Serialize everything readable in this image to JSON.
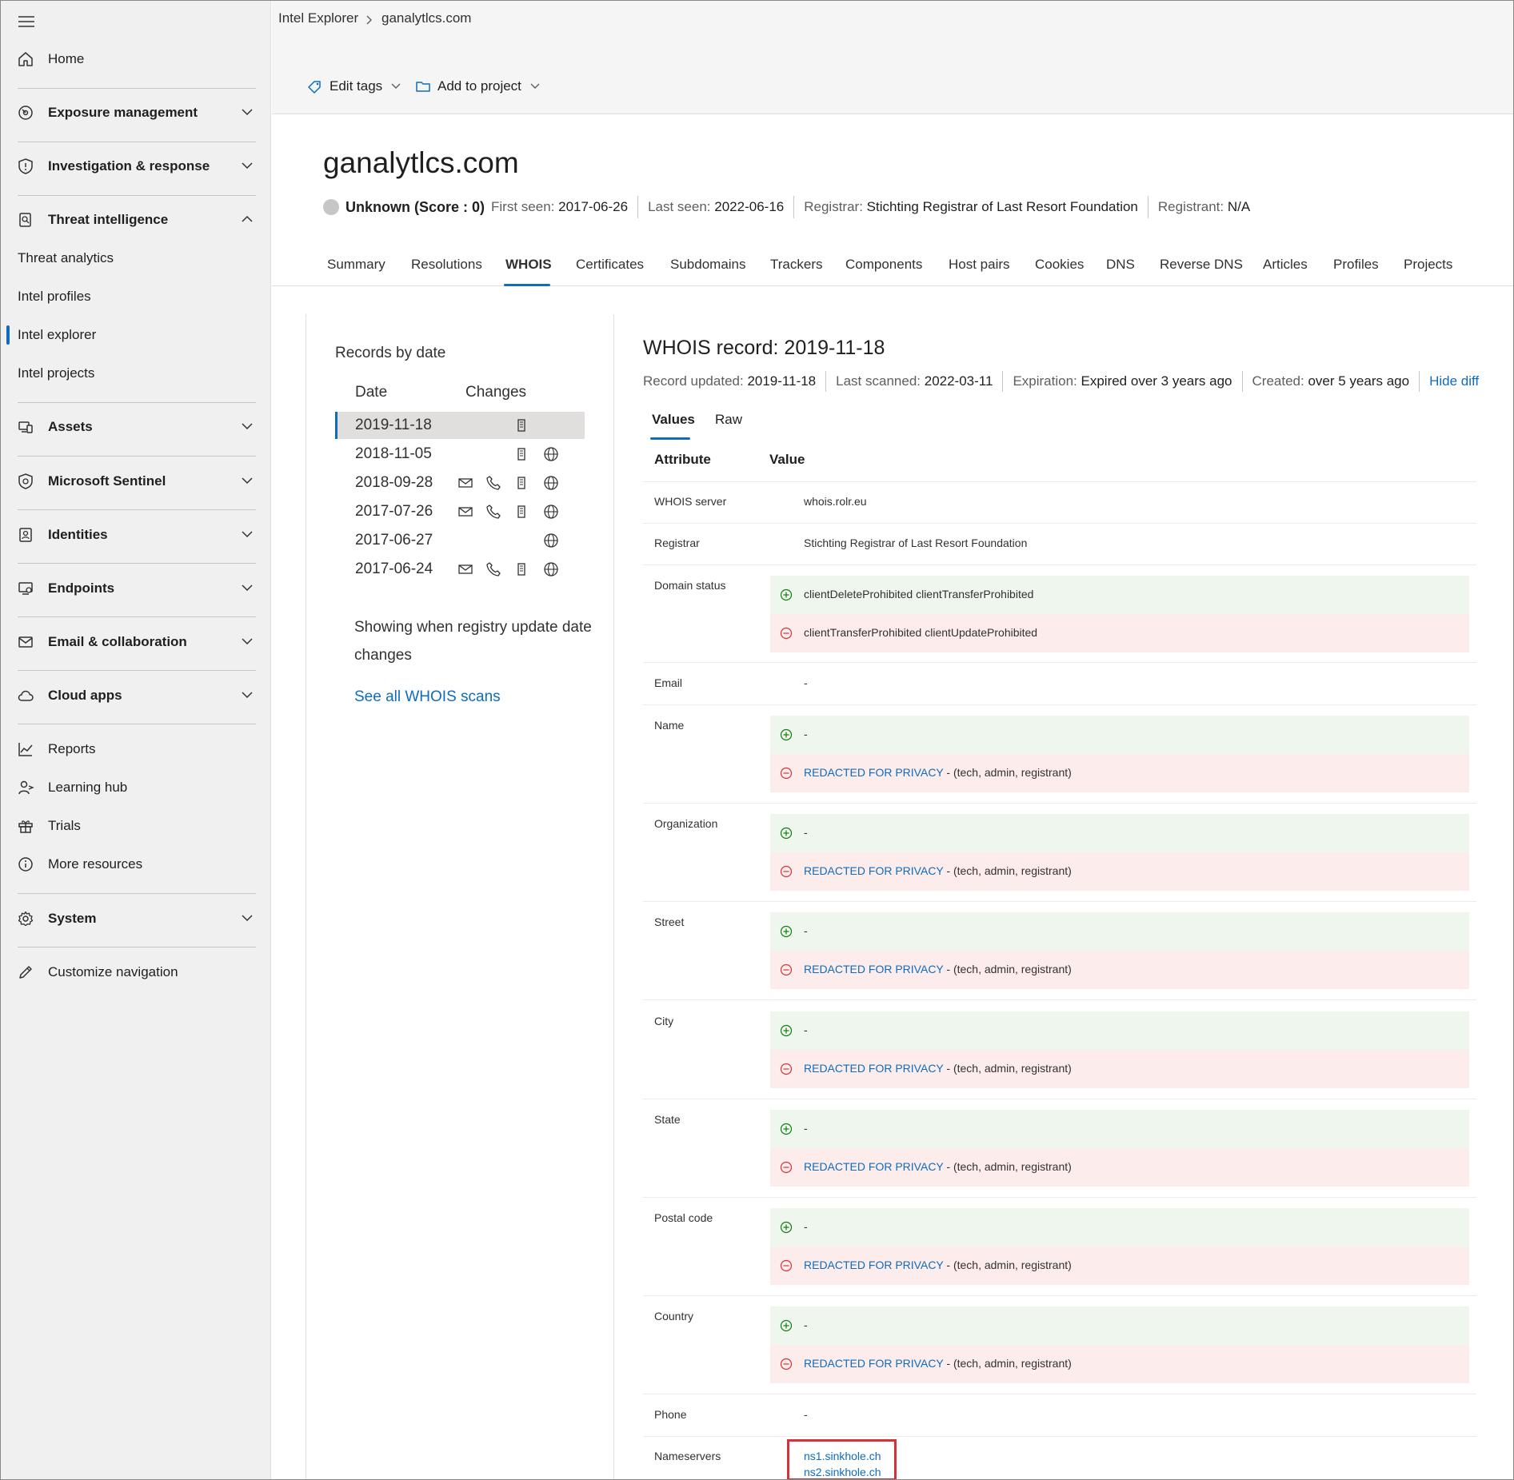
{
  "breadcrumb": {
    "root": "Intel Explorer",
    "current": "ganalytlcs.com"
  },
  "sidebar": {
    "home": "Home",
    "exposure": "Exposure management",
    "investigation": "Investigation & response",
    "threat_intel": "Threat intelligence",
    "threat_analytics": "Threat analytics",
    "intel_profiles": "Intel profiles",
    "intel_explorer": "Intel explorer",
    "intel_projects": "Intel projects",
    "assets": "Assets",
    "sentinel": "Microsoft Sentinel",
    "identities": "Identities",
    "endpoints": "Endpoints",
    "email": "Email & collaboration",
    "cloud_apps": "Cloud apps",
    "reports": "Reports",
    "learning_hub": "Learning hub",
    "trials": "Trials",
    "more_resources": "More resources",
    "system": "System",
    "customize": "Customize navigation"
  },
  "commands": {
    "edit_tags": "Edit tags",
    "add_to_project": "Add to project"
  },
  "header": {
    "title": "ganalytlcs.com",
    "score": "Unknown (Score : 0)",
    "first_seen_label": "First seen:",
    "first_seen": "2017-06-26",
    "last_seen_label": "Last seen:",
    "last_seen": "2022-06-16",
    "registrar_label": "Registrar:",
    "registrar": "Stichting Registrar of Last Resort Foundation",
    "registrant_label": "Registrant:",
    "registrant": "N/A"
  },
  "tabs": {
    "summary": "Summary",
    "resolutions": "Resolutions",
    "whois": "WHOIS",
    "certificates": "Certificates",
    "subdomains": "Subdomains",
    "trackers": "Trackers",
    "components": "Components",
    "host_pairs": "Host pairs",
    "cookies": "Cookies",
    "dns": "DNS",
    "reverse_dns": "Reverse DNS",
    "articles": "Articles",
    "profiles": "Profiles",
    "projects": "Projects"
  },
  "records": {
    "title": "Records by date",
    "col_date": "Date",
    "col_changes": "Changes",
    "rows": [
      {
        "date": "2019-11-18"
      },
      {
        "date": "2018-11-05"
      },
      {
        "date": "2018-09-28"
      },
      {
        "date": "2017-07-26"
      },
      {
        "date": "2017-06-27"
      },
      {
        "date": "2017-06-24"
      }
    ],
    "note": "Showing when registry update date changes",
    "link": "See all WHOIS scans"
  },
  "whois": {
    "title": "WHOIS record: 2019-11-18",
    "updated_label": "Record updated:",
    "updated": "2019-11-18",
    "scanned_label": "Last scanned:",
    "scanned": "2022-03-11",
    "expiration_label": "Expiration:",
    "expiration": "Expired over 3 years ago",
    "created_label": "Created:",
    "created": "over 5 years ago",
    "hide_diff": "Hide diff",
    "pivot_values": "Values",
    "pivot_raw": "Raw",
    "col_attribute": "Attribute",
    "col_value": "Value",
    "redacted": "REDACTED FOR PRIVACY",
    "redacted_suffix": "- (tech, admin, registrant)",
    "dash": "-",
    "server_label": "WHOIS server",
    "server": "whois.rolr.eu",
    "registrar_label": "Registrar",
    "registrar": "Stichting Registrar of Last Resort Foundation",
    "status_label": "Domain status",
    "status_added": "clientDeleteProhibited clientTransferProhibited",
    "status_removed": "clientTransferProhibited clientUpdateProhibited",
    "email_label": "Email",
    "name_label": "Name",
    "org_label": "Organization",
    "street_label": "Street",
    "city_label": "City",
    "state_label": "State",
    "postal_label": "Postal code",
    "country_label": "Country",
    "phone_label": "Phone",
    "ns_label": "Nameservers",
    "ns1": "ns1.sinkhole.ch",
    "ns2": "ns2.sinkhole.ch"
  },
  "colors": {
    "accent": "#0f6cbd",
    "added_bg": "#eff6ee",
    "removed_bg": "#fdecec",
    "highlight": "#d13438"
  }
}
